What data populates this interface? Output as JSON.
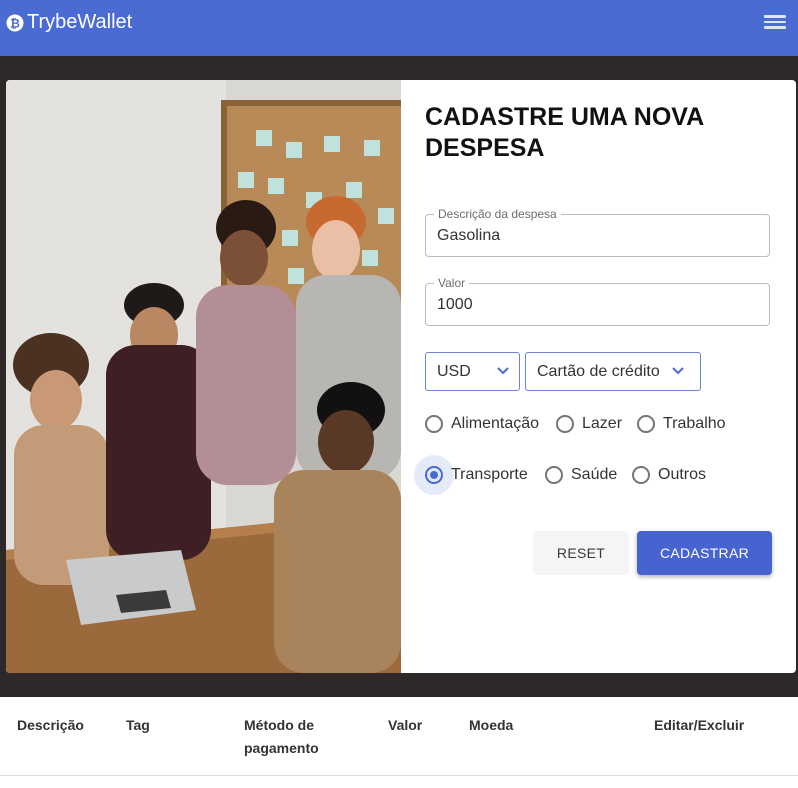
{
  "appbar": {
    "brand_name": "TrybeWallet",
    "logo_icon": "bitcoin-coin-icon",
    "menu_icon": "hamburger-menu-icon",
    "color": "#4a6bd1"
  },
  "form": {
    "title": "CADASTRE UMA NOVA DESPESA",
    "description": {
      "label": "Descrição da despesa",
      "value": "Gasolina"
    },
    "amount": {
      "label": "Valor",
      "value": "1000"
    },
    "currency": {
      "selected": "USD",
      "options": [
        "USD"
      ]
    },
    "payment_method": {
      "selected": "Cartão de crédito"
    },
    "tags": [
      {
        "label": "Alimentação",
        "checked": false
      },
      {
        "label": "Lazer",
        "checked": false
      },
      {
        "label": "Trabalho",
        "checked": false
      },
      {
        "label": "Transporte",
        "checked": true
      },
      {
        "label": "Saúde",
        "checked": false
      },
      {
        "label": "Outros",
        "checked": false
      }
    ],
    "reset_label": "RESET",
    "submit_label": "CADASTRAR"
  },
  "table": {
    "headers": [
      "Descrição",
      "Tag",
      "Método de pagamento",
      "Valor",
      "Moeda",
      "Editar/Excluir"
    ]
  },
  "colors": {
    "primary": "#4763cf",
    "dark_band": "#2e2828"
  }
}
